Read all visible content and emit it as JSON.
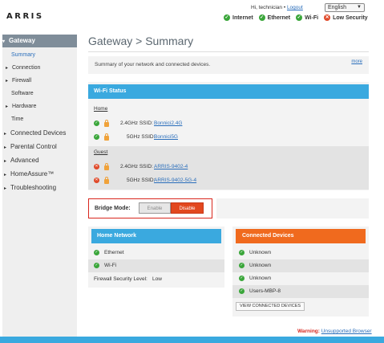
{
  "header": {
    "logo": "ARRIS",
    "greeting": "Hi, technician",
    "separator": "•",
    "logout": "Logout",
    "language": "English",
    "status": {
      "internet": "Internet",
      "ethernet": "Ethernet",
      "wifi": "Wi-Fi",
      "security": "Low Security"
    }
  },
  "sidebar": {
    "gateway": "Gateway",
    "items": [
      "Summary",
      "Connection",
      "Firewall",
      "Software",
      "Hardware",
      "Time"
    ],
    "main": [
      "Connected Devices",
      "Parental Control",
      "Advanced",
      "HomeAssure™",
      "Troubleshooting"
    ]
  },
  "page": {
    "title": "Gateway > Summary",
    "summary_text": "Summary of your network and connected devices.",
    "more": "more"
  },
  "wifi": {
    "title": "Wi-Fi Status",
    "home_label": "Home",
    "guest_label": "Guest",
    "home": [
      {
        "prefix": "2.4GHz SSID:",
        "ssid": "Bonnici2.4G"
      },
      {
        "prefix": "5GHz SSID:",
        "ssid": "Bonnici5G"
      }
    ],
    "guest": [
      {
        "prefix": "2.4GHz SSID:",
        "ssid": "ARRIS-9402-4"
      },
      {
        "prefix": "5GHz SSID:",
        "ssid": "ARRIS-9402-5G-4"
      }
    ]
  },
  "bridge": {
    "label": "Bridge Mode:",
    "enable": "Enable",
    "disable": "Disable"
  },
  "home_network": {
    "title": "Home Network",
    "items": [
      "Ethernet",
      "Wi-Fi"
    ],
    "firewall_label": "Firewall Security Level:",
    "firewall_value": "Low"
  },
  "connected_devices": {
    "title": "Connected Devices",
    "items": [
      "Unknown",
      "Unknown",
      "Unknown",
      "Users-MBP-8"
    ],
    "button": "VIEW CONNECTED DEVICES"
  },
  "footer": {
    "warning": "Warning:",
    "link": "Unsupported Browser"
  },
  "colors": {
    "accent_blue": "#3aa9df",
    "accent_orange": "#f06a1e",
    "ok_green": "#3aa63a",
    "alert_red": "#e04a2a"
  }
}
